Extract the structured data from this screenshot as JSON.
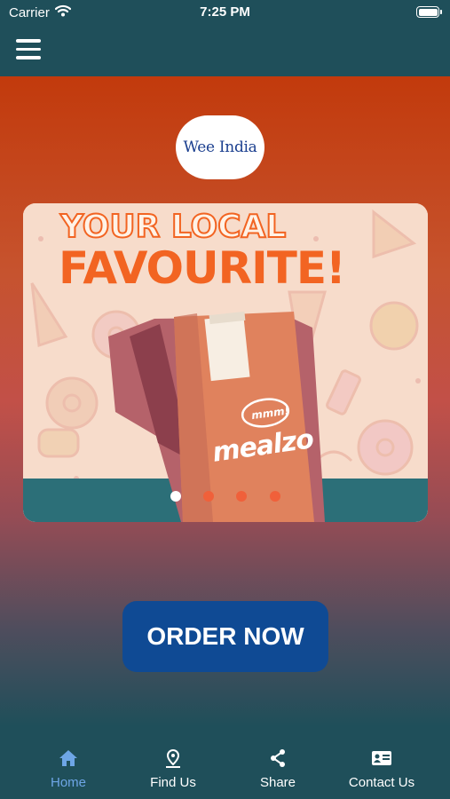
{
  "status_bar": {
    "carrier": "Carrier",
    "time": "7:25 PM"
  },
  "header": {
    "menu_icon": "hamburger-menu-icon"
  },
  "logo": {
    "text": "Wee India"
  },
  "banner": {
    "headline_line1": "YOUR LOCAL",
    "headline_line2": "FAVOURITE!",
    "bag_tagline": "mmm!",
    "brand": "mealzo",
    "slides_total": 4,
    "active_slide": 1
  },
  "order_button": {
    "label": "ORDER NOW"
  },
  "tabs": [
    {
      "label": "Home",
      "icon": "home-icon",
      "active": true
    },
    {
      "label": "Find Us",
      "icon": "location-pin-icon",
      "active": false
    },
    {
      "label": "Share",
      "icon": "share-icon",
      "active": false
    },
    {
      "label": "Contact Us",
      "icon": "contact-card-icon",
      "active": false
    }
  ],
  "colors": {
    "bar_background": "#1f4f5a",
    "gradient_top": "#c23a0c",
    "button": "#0f4a94",
    "active_tab": "#6ea6e6",
    "accent_orange": "#f26422"
  }
}
